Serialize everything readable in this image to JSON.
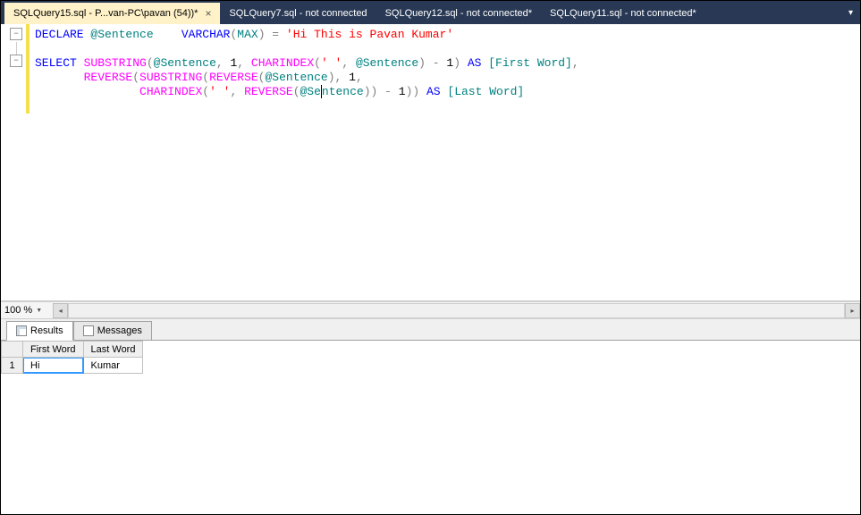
{
  "tabs": [
    {
      "label": "SQLQuery15.sql - P...van-PC\\pavan (54))*",
      "active": true
    },
    {
      "label": "SQLQuery7.sql - not connected",
      "active": false
    },
    {
      "label": "SQLQuery12.sql - not connected*",
      "active": false
    },
    {
      "label": "SQLQuery11.sql - not connected*",
      "active": false
    }
  ],
  "editor": {
    "zoom": "100 %",
    "code": {
      "l1": {
        "kw1": "DECLARE",
        "var1": "@Sentence",
        "type": "VARCHAR",
        "paren_o": "(",
        "max": "MAX",
        "paren_c": ")",
        "eq": " = ",
        "str": "'Hi This is Pavan Kumar'"
      },
      "l3": {
        "kw1": "SELECT",
        "fn1": "SUBSTRING",
        "p1": "(",
        "var1": "@Sentence",
        "c1": ", ",
        "n1": "1",
        "c2": ", ",
        "fn2": "CHARINDEX",
        "p2": "(",
        "str1": "' '",
        "c3": ", ",
        "var2": "@Sentence",
        "p3": ")",
        "op1": " - ",
        "n2": "1",
        "p4": ")",
        "kw2": " AS ",
        "alias": "[First Word]",
        "c4": ","
      },
      "l4": {
        "fn1": "REVERSE",
        "p1": "(",
        "fn2": "SUBSTRING",
        "p2": "(",
        "fn3": "REVERSE",
        "p3": "(",
        "var1": "@Sentence",
        "p4": ")",
        "c1": ", ",
        "n1": "1",
        "c2": ","
      },
      "l5": {
        "fn1": "CHARINDEX",
        "p1": "(",
        "str1": "' '",
        "c1": ", ",
        "fn2": "REVERSE",
        "p2": "(",
        "var1a": "@Se",
        "var1b": "ntence",
        "p3": ")",
        "p4": ")",
        "op1": " - ",
        "n1": "1",
        "p5": ")",
        "p6": ")",
        "kw1": " AS ",
        "alias": "[Last Word]"
      }
    }
  },
  "result_tabs": {
    "results": "Results",
    "messages": "Messages"
  },
  "grid": {
    "headers": [
      "First Word",
      "Last Word"
    ],
    "rows": [
      {
        "n": "1",
        "cells": [
          "Hi",
          "Kumar"
        ]
      }
    ]
  }
}
